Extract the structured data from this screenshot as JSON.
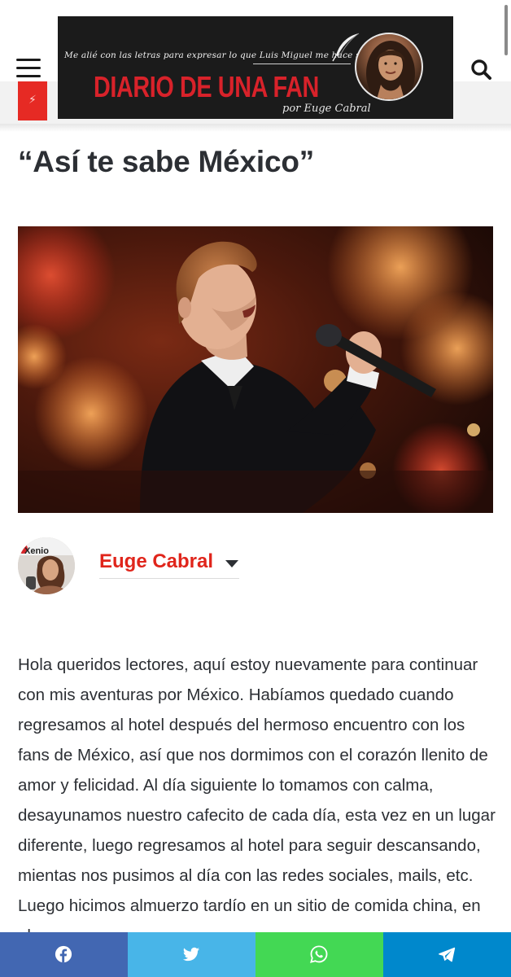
{
  "header": {
    "banner": {
      "tagline": "Me alié con las letras para expresar lo que Luis Miguel me hace sentir",
      "title": "DIARIO DE UNA FAN",
      "byline": "por Euge Cabral"
    },
    "menu_icon": "hamburger-menu-icon",
    "search_icon": "search-icon"
  },
  "post": {
    "title": "“Así te sabe México”",
    "author": {
      "name": "Euge Cabral",
      "avatar_text": "Xenio"
    },
    "body": "Hola queridos lectores, aquí estoy nuevamente para continuar con mis aventuras por México. Habíamos quedado cuando regresamos al hotel después del hermoso encuentro con los fans de México, así que nos dormimos con el corazón llenito de amor y felicidad. Al día siguiente lo tomamos con calma, desayunamos nuestro cafecito de cada día, esta vez en un lugar diferente, luego regresamos al hotel para seguir descansando, mientas nos pusimos al día con las redes sociales, mails, etc. Luego hicimos almuerzo tardío en un sitio de comida china, en el que por"
  },
  "share_bar": {
    "buttons": [
      {
        "name": "facebook",
        "icon": "facebook-icon",
        "color": "#4267b2"
      },
      {
        "name": "twitter",
        "icon": "twitter-icon",
        "color": "#48b5e8"
      },
      {
        "name": "whatsapp",
        "icon": "whatsapp-icon",
        "color": "#43d854"
      },
      {
        "name": "telegram",
        "icon": "telegram-icon",
        "color": "#0088cc"
      }
    ]
  },
  "colors": {
    "accent": "#e0251b",
    "banner_background": "#1b1b1b",
    "banner_title": "#d8222a",
    "text": "#2c2f34"
  }
}
